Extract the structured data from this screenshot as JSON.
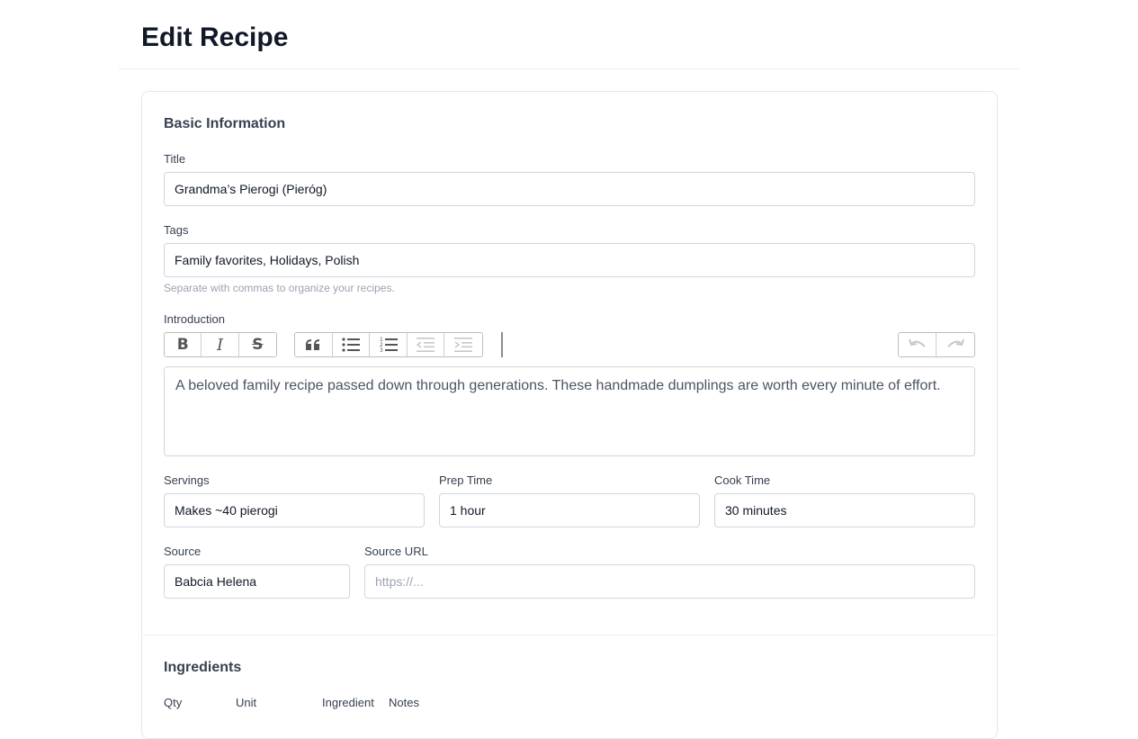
{
  "page": {
    "title": "Edit Recipe"
  },
  "basic_info": {
    "section_title": "Basic Information",
    "title": {
      "label": "Title",
      "value": "Grandma’s Pierogi (Pieróg)"
    },
    "tags": {
      "label": "Tags",
      "value": "Family favorites, Holidays, Polish",
      "help": "Separate with commas to organize your recipes."
    },
    "introduction": {
      "label": "Introduction",
      "value": "A beloved family recipe passed down through generations. These handmade dumplings are worth every minute of effort."
    },
    "toolbar": {
      "formatting": [
        {
          "name": "bold-button",
          "icon": "bold-icon"
        },
        {
          "name": "italic-button",
          "icon": "italic-icon"
        },
        {
          "name": "strikethrough-button",
          "icon": "strikethrough-icon"
        }
      ],
      "blocks": [
        {
          "name": "quote-button",
          "icon": "quote-icon",
          "disabled": false
        },
        {
          "name": "bullet-list-button",
          "icon": "bullet-list-icon",
          "disabled": false
        },
        {
          "name": "numbered-list-button",
          "icon": "numbered-list-icon",
          "disabled": false
        },
        {
          "name": "outdent-button",
          "icon": "outdent-icon",
          "disabled": true
        },
        {
          "name": "indent-button",
          "icon": "indent-icon",
          "disabled": true
        }
      ],
      "history": [
        {
          "name": "undo-button",
          "icon": "undo-icon",
          "disabled": true
        },
        {
          "name": "redo-button",
          "icon": "redo-icon",
          "disabled": true
        }
      ]
    },
    "servings": {
      "label": "Servings",
      "value": "Makes ~40 pierogi"
    },
    "prep_time": {
      "label": "Prep Time",
      "value": "1 hour"
    },
    "cook_time": {
      "label": "Cook Time",
      "value": "30 minutes"
    },
    "source": {
      "label": "Source",
      "value": "Babcia Helena"
    },
    "source_url": {
      "label": "Source URL",
      "value": "",
      "placeholder": "https://..."
    }
  },
  "ingredients": {
    "section_title": "Ingredients",
    "columns": [
      "Qty",
      "Unit",
      "Ingredient",
      "Notes"
    ]
  }
}
